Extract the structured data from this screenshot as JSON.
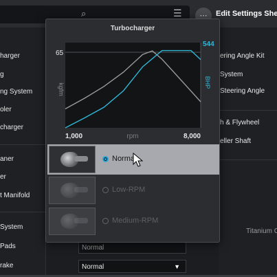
{
  "window": {
    "title": "Edit Settings Sheet",
    "search_icon": "search-icon",
    "menu_icon": "list-icon"
  },
  "left_column": [
    "harger",
    "g",
    "ng System",
    "oler",
    "charger",
    "aner",
    "er",
    "t Manifold",
    "System",
    "Pads",
    "rake"
  ],
  "right_column": [
    "ering Angle Kit",
    "System",
    "Steering Angle",
    "h & Flywheel",
    "eller Shaft",
    "Titanium C"
  ],
  "fields": {
    "pads_value": "Normal",
    "brake_value": "Normal"
  },
  "popup": {
    "title": "Turbocharger",
    "options": [
      {
        "label": "Normal",
        "selected": true
      },
      {
        "label": "Low-RPM",
        "selected": false
      },
      {
        "label": "Medium-RPM",
        "selected": false
      }
    ]
  },
  "colors": {
    "torque": "#9a9a9a",
    "power": "#2fb8d8",
    "selected_row": "#a7a9ae",
    "radio_accent": "#2aa7d6"
  },
  "chart_data": {
    "type": "line",
    "xlabel": "rpm",
    "ylabel_left": "kgfm",
    "ylabel_right": "BHP",
    "x_ticks": [
      "1,000",
      "8,000"
    ],
    "xlim": [
      1000,
      8000
    ],
    "left_tick": "65",
    "right_tick": "544",
    "series": [
      {
        "axis": "left",
        "x": [
          1000,
          2000,
          3000,
          4000,
          5000,
          5500,
          6000,
          7000,
          8000
        ],
        "y": [
          16,
          25,
          35,
          47,
          62,
          65,
          58,
          40,
          22
        ],
        "ylim": [
          0,
          72
        ]
      },
      {
        "axis": "right",
        "x": [
          1000,
          2000,
          3000,
          4000,
          5000,
          6000,
          6500,
          7000,
          7500,
          8000
        ],
        "y": [
          0,
          70,
          145,
          260,
          430,
          544,
          544,
          544,
          544,
          480
        ],
        "ylim": [
          0,
          600
        ]
      }
    ]
  }
}
